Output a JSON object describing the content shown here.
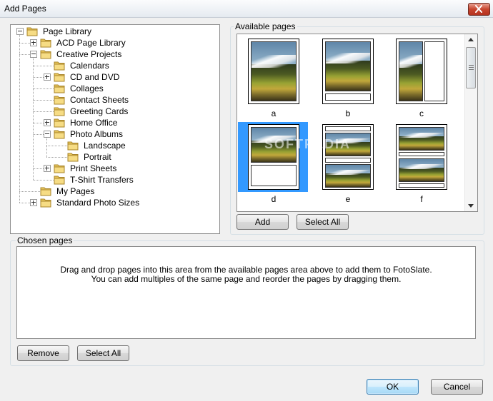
{
  "window": {
    "title": "Add Pages"
  },
  "tree": {
    "items": [
      {
        "label": "Page Library",
        "level": 0,
        "expander": "minus"
      },
      {
        "label": "ACD Page Library",
        "level": 1,
        "expander": "plus"
      },
      {
        "label": "Creative Projects",
        "level": 1,
        "expander": "minus"
      },
      {
        "label": "Calendars",
        "level": 2,
        "expander": "none"
      },
      {
        "label": "CD and DVD",
        "level": 2,
        "expander": "plus"
      },
      {
        "label": "Collages",
        "level": 2,
        "expander": "none"
      },
      {
        "label": "Contact Sheets",
        "level": 2,
        "expander": "none"
      },
      {
        "label": "Greeting Cards",
        "level": 2,
        "expander": "none"
      },
      {
        "label": "Home Office",
        "level": 2,
        "expander": "plus"
      },
      {
        "label": "Photo Albums",
        "level": 2,
        "expander": "minus"
      },
      {
        "label": "Landscape",
        "level": 3,
        "expander": "none"
      },
      {
        "label": "Portrait",
        "level": 3,
        "expander": "none"
      },
      {
        "label": "Print Sheets",
        "level": 2,
        "expander": "plus"
      },
      {
        "label": "T-Shirt Transfers",
        "level": 2,
        "expander": "none"
      },
      {
        "label": "My Pages",
        "level": 1,
        "expander": "none"
      },
      {
        "label": "Standard Photo Sizes",
        "level": 1,
        "expander": "plus"
      }
    ]
  },
  "available": {
    "label": "Available pages",
    "pages": [
      {
        "caption": "a",
        "layout": "full-photo",
        "selected": false
      },
      {
        "caption": "b",
        "layout": "photo-caption",
        "selected": false
      },
      {
        "caption": "c",
        "layout": "photo-side",
        "selected": false
      },
      {
        "caption": "d",
        "layout": "photo-textbox",
        "selected": true
      },
      {
        "caption": "e",
        "layout": "two-photos-captions",
        "selected": false
      },
      {
        "caption": "f",
        "layout": "two-photos",
        "selected": false
      }
    ],
    "add_label": "Add",
    "select_all_label": "Select All"
  },
  "chosen": {
    "label": "Chosen pages",
    "hint_line1": "Drag and drop pages into this area from the available pages area above to add them to FotoSlate.",
    "hint_line2": "You can add multiples of the same page and reorder the pages by dragging them.",
    "remove_label": "Remove",
    "select_all_label": "Select All"
  },
  "footer": {
    "ok_label": "OK",
    "cancel_label": "Cancel"
  },
  "watermark": "SOFTPEDIA",
  "colors": {
    "selection": "#3399ff",
    "folder": "#e8c65a"
  }
}
